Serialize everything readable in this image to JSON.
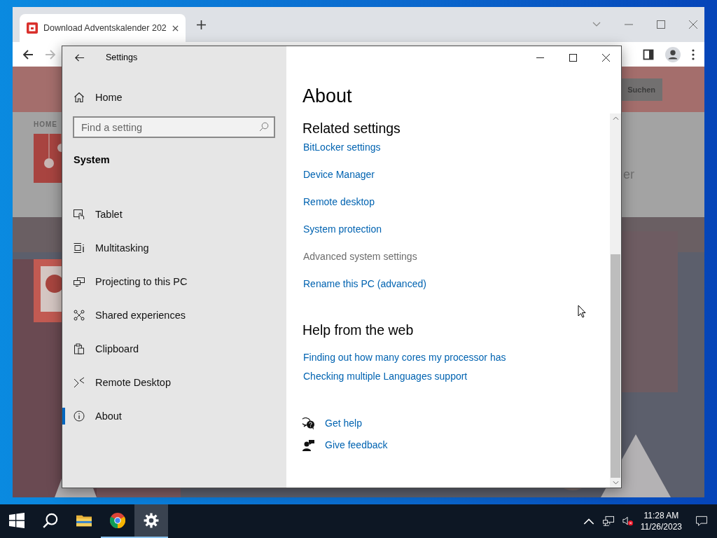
{
  "browser": {
    "tab_title": "Download Adventskalender 202",
    "page": {
      "search_button": "Suchen",
      "breadcrumb": "HOME",
      "heading_fragment": "er"
    }
  },
  "settings": {
    "title": "Settings",
    "home": "Home",
    "search": {
      "placeholder": "Find a setting"
    },
    "section": "System",
    "nav": [
      {
        "label": "Tablet",
        "kind": "tablet",
        "selected": false
      },
      {
        "label": "Multitasking",
        "kind": "multitasking",
        "selected": false
      },
      {
        "label": "Projecting to this PC",
        "kind": "projecting",
        "selected": false
      },
      {
        "label": "Shared experiences",
        "kind": "shared",
        "selected": false
      },
      {
        "label": "Clipboard",
        "kind": "clipboard",
        "selected": false
      },
      {
        "label": "Remote Desktop",
        "kind": "remote",
        "selected": false
      },
      {
        "label": "About",
        "kind": "about",
        "selected": true
      }
    ],
    "content": {
      "title": "About",
      "related_heading": "Related settings",
      "related_links": [
        {
          "label": "BitLocker settings",
          "disabled": false
        },
        {
          "label": "Device Manager",
          "disabled": false
        },
        {
          "label": "Remote desktop",
          "disabled": false
        },
        {
          "label": "System protection",
          "disabled": false
        },
        {
          "label": "Advanced system settings",
          "disabled": true
        },
        {
          "label": "Rename this PC (advanced)",
          "disabled": false
        }
      ],
      "help_heading": "Help from the web",
      "help_links": [
        "Finding out how many cores my processor has",
        "Checking multiple Languages support"
      ],
      "support_links": [
        {
          "label": "Get help",
          "kind": "help"
        },
        {
          "label": "Give feedback",
          "kind": "feedback"
        }
      ]
    }
  },
  "taskbar": {
    "apps": [
      {
        "kind": "explorer",
        "running": false,
        "active": false
      },
      {
        "kind": "chrome",
        "running": true,
        "active": false
      },
      {
        "kind": "settings",
        "running": true,
        "active": true
      }
    ],
    "time": "11:28 AM",
    "date": "11/26/2023"
  }
}
